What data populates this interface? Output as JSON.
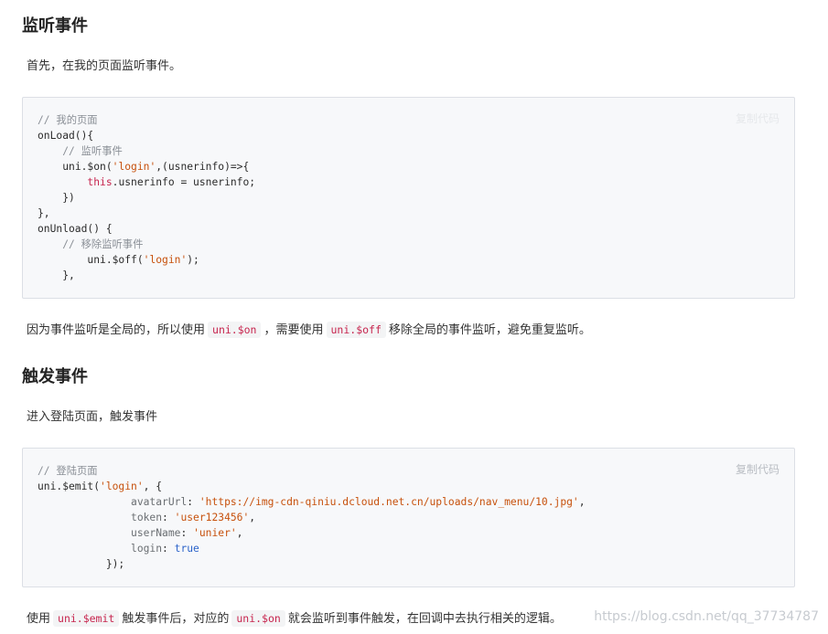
{
  "section1": {
    "title": "监听事件",
    "intro": "首先，在我的页面监听事件。",
    "copy_label": "复制代码",
    "code": {
      "l1_comment": "// 我的页面",
      "l2": "onLoad(){",
      "l3_comment": "// 监听事件",
      "l4_a": "uni.$on(",
      "l4_str": "'login'",
      "l4_b": ",(usnerinfo)=>{",
      "l5_kw": "this",
      "l5_rest": ".usnerinfo = usnerinfo;",
      "l6": "})",
      "l7": "},",
      "l8": "onUnload() {",
      "l9_comment": "// 移除监听事件",
      "l10_a": "uni.$off(",
      "l10_str": "'login'",
      "l10_b": ");",
      "l11": "},"
    },
    "note_a": "因为事件监听是全局的，所以使用",
    "note_code1": "uni.$on",
    "note_b": "，需要使用",
    "note_code2": "uni.$off",
    "note_c": "移除全局的事件监听，避免重复监听。"
  },
  "section2": {
    "title": "触发事件",
    "intro": "进入登陆页面，触发事件",
    "copy_label": "复制代码",
    "code": {
      "l1_comment": "// 登陆页面",
      "l2_a": "uni.$emit(",
      "l2_str": "'login'",
      "l2_b": ", {",
      "l3_key": "avatarUrl",
      "l3_val": "'https://img-cdn-qiniu.dcloud.net.cn/uploads/nav_menu/10.jpg'",
      "l4_key": "token",
      "l4_val": "'user123456'",
      "l5_key": "userName",
      "l5_val": "'unier'",
      "l6_key": "login",
      "l6_val": "true",
      "l7": "});"
    },
    "note_a": "使用",
    "note_code1": "uni.$emit",
    "note_b": "触发事件后，对应的",
    "note_code2": "uni.$on",
    "note_c": "就会监听到事件触发，在回调中去执行相关的逻辑。"
  },
  "watermark": "https://blog.csdn.net/qq_37734787"
}
